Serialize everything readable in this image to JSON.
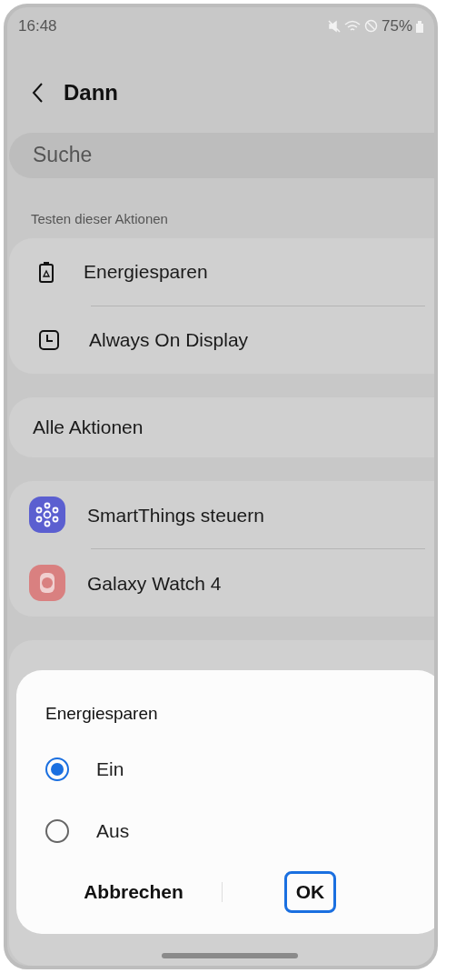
{
  "status_bar": {
    "time": "16:48",
    "battery": "75%"
  },
  "header": {
    "title": "Dann"
  },
  "search": {
    "placeholder": "Suche"
  },
  "section_label": "Testen dieser Aktionen",
  "suggested": [
    {
      "label": "Energiesparen",
      "kind": "battery"
    },
    {
      "label": "Always On Display",
      "kind": "clock"
    }
  ],
  "all_actions": "Alle Aktionen",
  "apps": [
    {
      "label": "SmartThings steuern",
      "kind": "hub",
      "color": "#5b5fd0"
    },
    {
      "label": "Galaxy Watch 4",
      "kind": "watch",
      "color": "#d98080"
    }
  ],
  "dialog": {
    "title": "Energiesparen",
    "options": [
      {
        "label": "Ein",
        "selected": true
      },
      {
        "label": "Aus",
        "selected": false
      }
    ],
    "buttons": [
      {
        "label": "Abbrechen",
        "focused": false
      },
      {
        "label": "OK",
        "focused": true
      }
    ]
  }
}
